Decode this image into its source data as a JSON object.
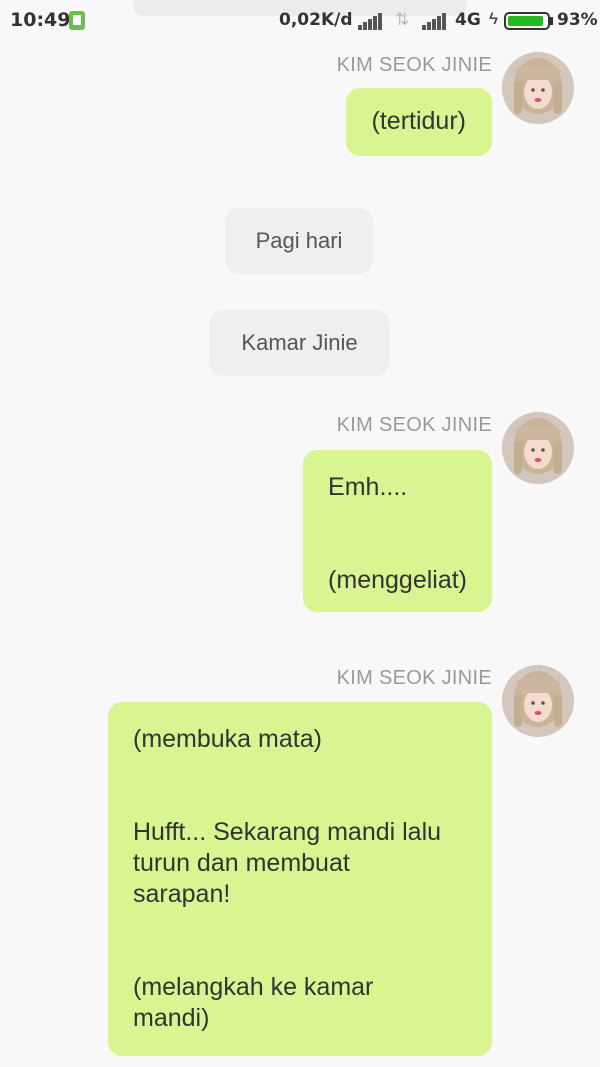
{
  "status_bar": {
    "time": "10:49",
    "network_speed": "0,02K/d",
    "network_type": "4G",
    "battery_percent": "93%",
    "battery_level": 0.93
  },
  "messages": [
    {
      "type": "outgoing",
      "sender": "KIM SEOK JINIE",
      "lines": [
        "(tertidur)"
      ]
    },
    {
      "type": "narration",
      "text": "Pagi hari"
    },
    {
      "type": "narration",
      "text": "Kamar Jinie"
    },
    {
      "type": "outgoing",
      "sender": "KIM SEOK JINIE",
      "lines": [
        "Emh....",
        "",
        "",
        "(menggeliat)"
      ]
    },
    {
      "type": "outgoing",
      "sender": "KIM SEOK JINIE",
      "lines": [
        "(membuka mata)",
        "",
        "",
        "Hufft... Sekarang mandi lalu",
        "turun dan membuat",
        "sarapan!",
        "",
        "",
        "(melangkah ke kamar",
        "mandi)"
      ]
    }
  ]
}
